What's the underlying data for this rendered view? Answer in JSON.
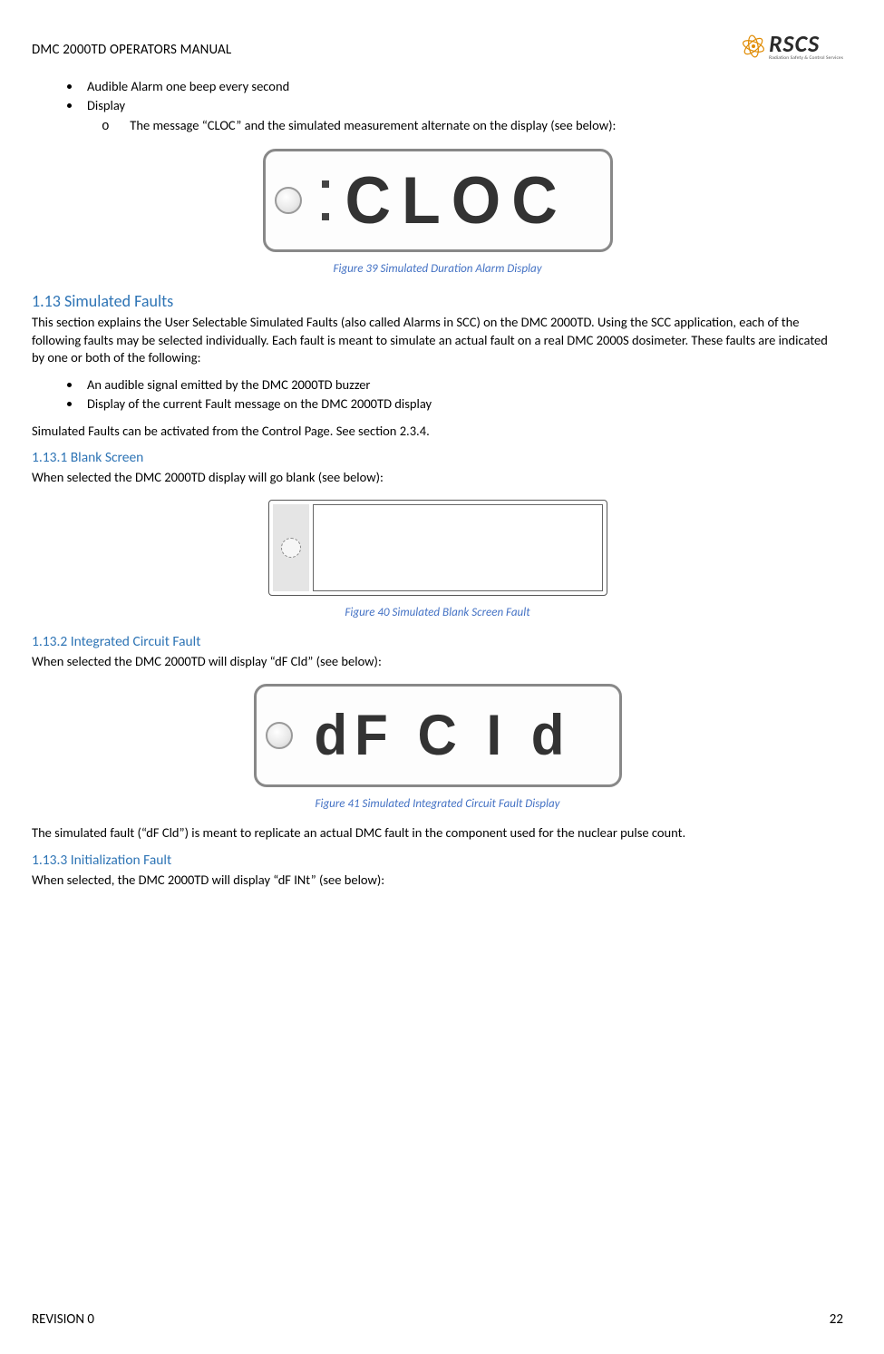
{
  "header": {
    "title": "DMC 2000TD OPERATORS MANUAL",
    "logo_text": "RSCS",
    "logo_sub": "Radiation Safety & Control Services"
  },
  "bullets_top": {
    "item1": "Audible Alarm one beep every second",
    "item2": "Display",
    "sub1": "The message “CLOC” and the simulated measurement alternate on the display (see below):"
  },
  "fig39": {
    "lcd_text": "CLOC",
    "caption": "Figure 39 Simulated Duration Alarm Display"
  },
  "sec113": {
    "heading": "1.13 Simulated Faults",
    "para": "This section explains the User Selectable Simulated Faults (also called Alarms in SCC) on the DMC 2000TD. Using the SCC application, each of the following faults may be selected individually. Each fault is meant to simulate an actual fault on a real DMC 2000S dosimeter. These faults are indicated by one or both of the following:",
    "b1": "An audible signal emitted by the DMC 2000TD buzzer",
    "b2": "Display of the current Fault message on the DMC 2000TD display",
    "para2": "Simulated Faults can be activated from the Control Page. See section 2.3.4."
  },
  "sec1131": {
    "heading": "1.13.1 Blank Screen",
    "para": "When selected the DMC 2000TD display will go blank (see below):"
  },
  "fig40": {
    "caption": "Figure 40 Simulated Blank Screen Fault"
  },
  "sec1132": {
    "heading": "1.13.2 Integrated Circuit Fault",
    "para": "When selected the DMC 2000TD will display “dF Cld” (see below):"
  },
  "fig41": {
    "lcd_text": "dF  C I d",
    "caption": "Figure 41 Simulated Integrated Circuit Fault Display"
  },
  "sec1132_para2": "The simulated fault (“dF Cld”) is meant to replicate an actual DMC fault in the component used for the nuclear pulse count.",
  "sec1133": {
    "heading": "1.13.3 Initialization Fault",
    "para": "When selected, the DMC 2000TD will display “dF INt” (see below):"
  },
  "footer": {
    "left": "REVISION 0",
    "right": "22"
  }
}
